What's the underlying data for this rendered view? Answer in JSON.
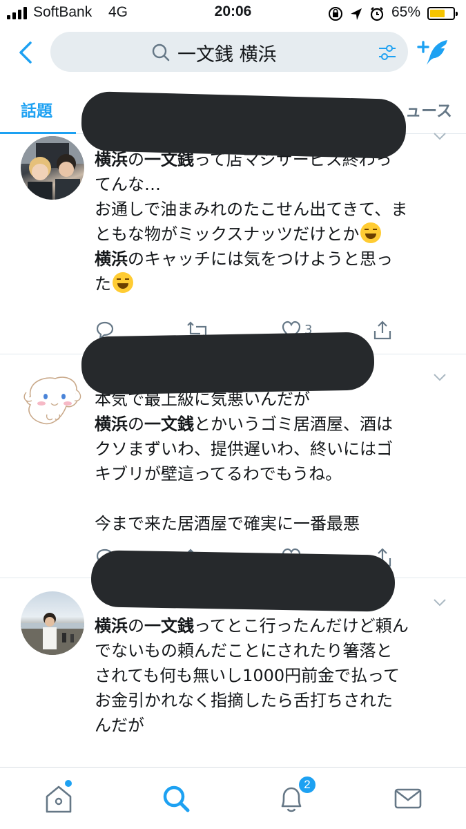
{
  "status_bar": {
    "carrier": "SoftBank",
    "network": "4G",
    "time": "20:06",
    "battery_percent_label": "65%",
    "battery_level": 0.65,
    "battery_color": "#f5c400"
  },
  "header": {
    "back_icon": "chevron-left-icon",
    "search_query": "一文銭 横浜",
    "search_icon": "search-icon",
    "filter_icon": "filter-sliders-icon",
    "compose_icon": "compose-tweet-icon"
  },
  "tabs": {
    "active_label": "話題",
    "news_label_visible": "ュース"
  },
  "accent_color": "#1da1f2",
  "tweets": [
    {
      "lines": [
        {
          "parts": [
            {
              "b": "横浜"
            },
            {
              "t": "の"
            },
            {
              "b": "一文銭"
            },
            {
              "t": "って店マジサービス終わっ"
            }
          ]
        },
        {
          "parts": [
            {
              "t": "てんな…"
            }
          ]
        },
        {
          "parts": [
            {
              "t": "お通しで油まみれのたこせん出てきて、ま"
            }
          ]
        },
        {
          "parts": [
            {
              "t": "ともな物がミックスナッツだけとか"
            }
          ],
          "emoji": "sweat-smile-emoji"
        },
        {
          "parts": [
            {
              "b": "横浜"
            },
            {
              "t": "のキャッチには気をつけようと思っ"
            }
          ]
        },
        {
          "parts": [
            {
              "t": "た"
            }
          ],
          "emoji": "tired-face-emoji"
        }
      ],
      "like_count": "3"
    },
    {
      "lines": [
        {
          "parts": [
            {
              "t": "本気で最上級に気悪いんだが"
            }
          ]
        },
        {
          "parts": [
            {
              "b": "横浜"
            },
            {
              "t": "の"
            },
            {
              "b": "一文銭"
            },
            {
              "t": "とかいうゴミ居酒屋、酒は"
            }
          ]
        },
        {
          "parts": [
            {
              "t": "クソまずいわ、提供遅いわ、終いにはゴ"
            }
          ]
        },
        {
          "parts": [
            {
              "t": "キブリが壁這ってるわでもうね。"
            }
          ]
        },
        {
          "parts": [
            {
              "t": ""
            }
          ]
        },
        {
          "parts": [
            {
              "t": "今まで来た居酒屋で確実に一番最悪"
            }
          ]
        }
      ]
    },
    {
      "lines": [
        {
          "parts": [
            {
              "b": "横浜"
            },
            {
              "t": "の"
            },
            {
              "b": "一文銭"
            },
            {
              "t": "ってとこ行ったんだけど頼ん"
            }
          ]
        },
        {
          "parts": [
            {
              "t": "でないもの頼んだことにされたり箸落と"
            }
          ]
        },
        {
          "parts": [
            {
              "t": "されても何も無いし1000円前金で払って"
            }
          ]
        },
        {
          "parts": [
            {
              "t": "お金引かれなく指摘したら舌打ちされた"
            }
          ]
        },
        {
          "parts": [
            {
              "t": "んだが"
            }
          ]
        }
      ]
    }
  ],
  "bottom_nav": {
    "items": [
      "home-icon",
      "search-icon",
      "notifications-icon",
      "messages-icon"
    ],
    "notification_badge": "2"
  }
}
